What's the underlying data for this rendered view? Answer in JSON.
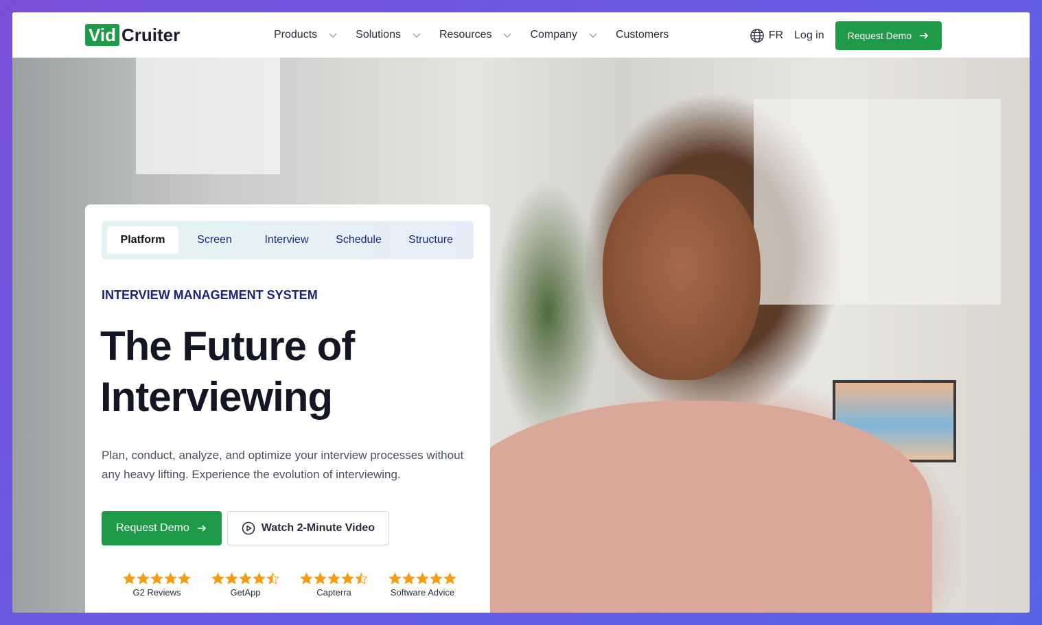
{
  "brand": {
    "logo_part1": "Vid",
    "logo_part2": "Cruiter",
    "accent": "#1e9a48",
    "navy": "#1b237a"
  },
  "nav": {
    "items": [
      {
        "label": "Products",
        "has_dropdown": true
      },
      {
        "label": "Solutions",
        "has_dropdown": true
      },
      {
        "label": "Resources",
        "has_dropdown": true
      },
      {
        "label": "Company",
        "has_dropdown": true
      },
      {
        "label": "Customers",
        "has_dropdown": false
      }
    ],
    "language": "FR",
    "login": "Log in",
    "request_demo": "Request Demo"
  },
  "hero": {
    "tabs": [
      "Platform",
      "Screen",
      "Interview",
      "Schedule",
      "Structure"
    ],
    "active_tab": "Platform",
    "eyebrow": "INTERVIEW MANAGEMENT SYSTEM",
    "headline_line1": "The Future of",
    "headline_line2": "Interviewing",
    "description": "Plan, conduct, analyze, and optimize your interview processes without any heavy lifting. Experience the evolution of interviewing.",
    "cta_primary": "Request Demo",
    "cta_secondary": "Watch 2-Minute Video",
    "ratings": [
      {
        "label": "G2 Reviews",
        "stars": 5
      },
      {
        "label": "GetApp",
        "stars": 4.5
      },
      {
        "label": "Capterra",
        "stars": 4.5
      },
      {
        "label": "Software Advice",
        "stars": 5
      }
    ],
    "star_color": "#f29d12"
  }
}
